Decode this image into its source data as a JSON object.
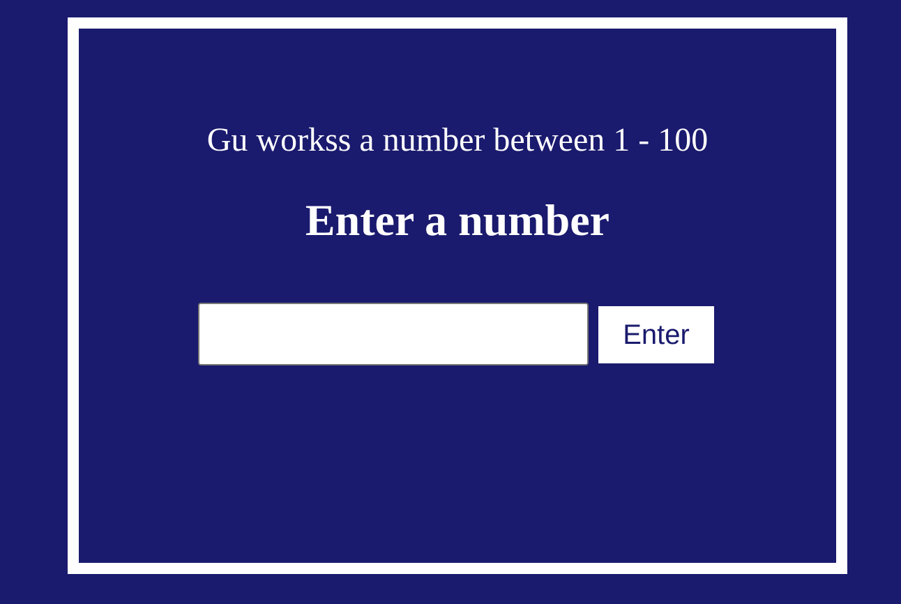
{
  "colors": {
    "background": "#1a1a6e",
    "frame_border": "#ffffff",
    "text": "#ffffff",
    "button_text": "#1a1a6e"
  },
  "game": {
    "subtitle": "Gu workss a number between 1 - 100",
    "title": "Enter a number",
    "input": {
      "value": "",
      "placeholder": ""
    },
    "enter_button_label": "Enter"
  }
}
